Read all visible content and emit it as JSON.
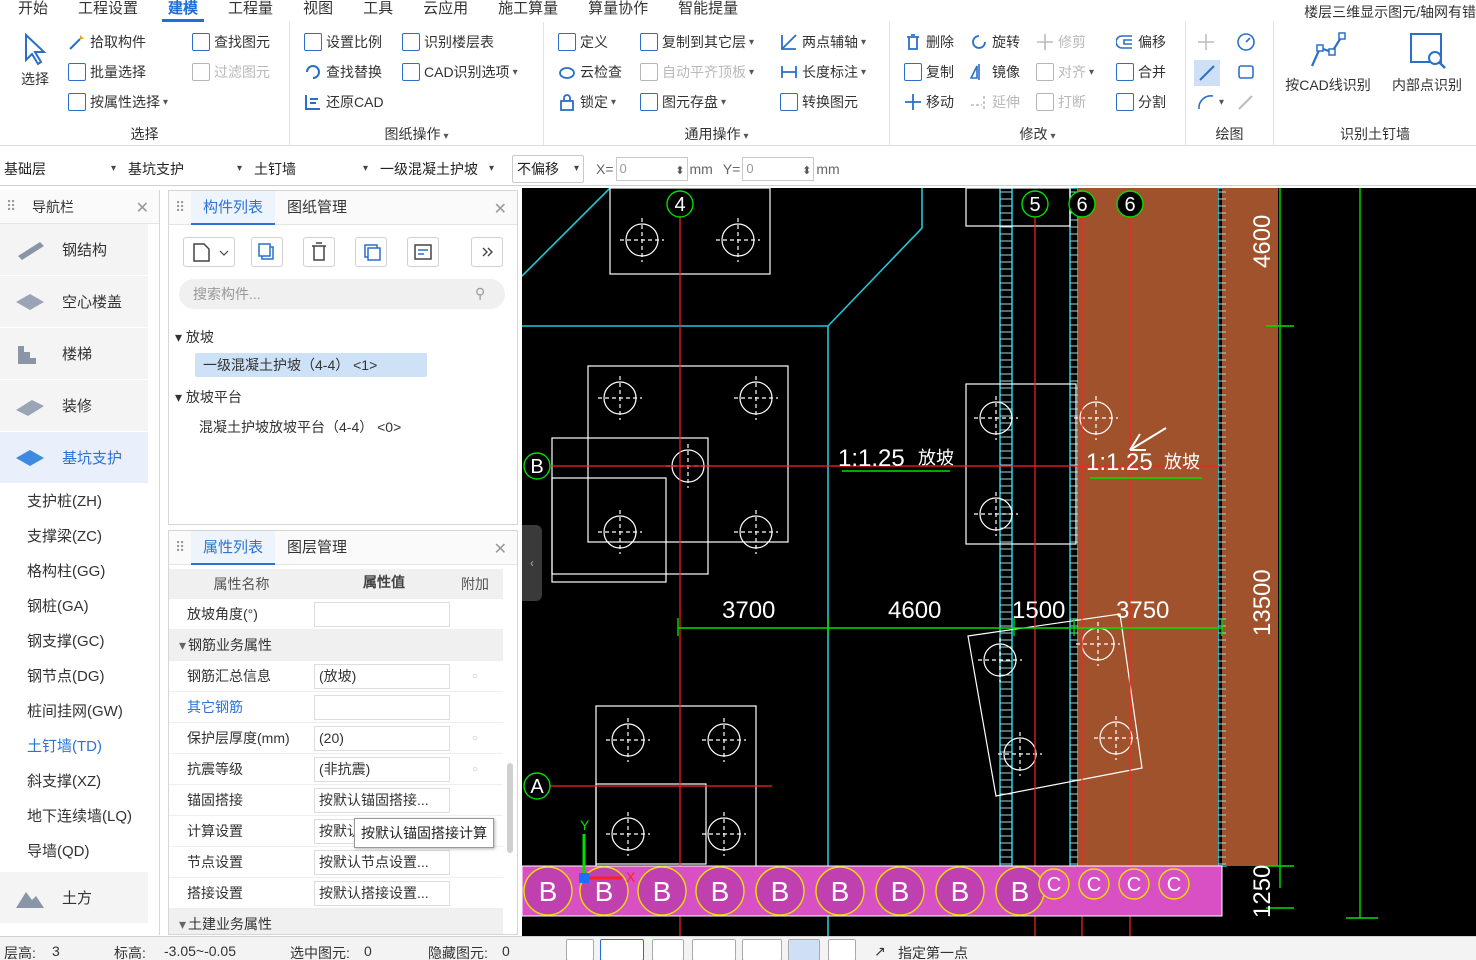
{
  "menu": {
    "items": [
      "开始",
      "工程设置",
      "建模",
      "工程量",
      "视图",
      "工具",
      "云应用",
      "施工算量",
      "算量协作",
      "智能提量"
    ],
    "active_index": 2,
    "right_text": "楼层三维显示图元/轴网有错"
  },
  "ribbon": {
    "select": {
      "select_label": "选择",
      "pick": "拾取构件",
      "batch": "批量选择",
      "by_attr": "按属性选择",
      "find": "查找图元",
      "filter": "过滤图元",
      "title": "选择"
    },
    "drawing": {
      "scale": "设置比例",
      "find_replace": "查找替换",
      "restore": "还原CAD",
      "identify_floor": "识别楼层表",
      "cad_options": "CAD识别选项",
      "title": "图纸操作"
    },
    "common": {
      "define": "定义",
      "cloud_check": "云检查",
      "lock": "锁定",
      "copy_floor": "复制到其它层",
      "auto_align": "自动平齐顶板",
      "store": "图元存盘",
      "aux": "两点辅轴",
      "dim": "长度标注",
      "convert": "转换图元",
      "title": "通用操作"
    },
    "modify": {
      "delete": "删除",
      "copy": "复制",
      "move": "移动",
      "rotate": "旋转",
      "mirror": "镜像",
      "extend": "延伸",
      "trim": "修剪",
      "align": "对齐",
      "break": "打断",
      "offset": "偏移",
      "merge": "合并",
      "split": "分割",
      "title": "修改"
    },
    "draw": {
      "title": "绘图"
    },
    "identify": {
      "by_line": "按CAD线识别",
      "inner": "内部点识别",
      "title": "识别土钉墙"
    }
  },
  "options": {
    "floor": "基础层",
    "category": "基坑支护",
    "type": "土钉墙",
    "component": "一级混凝土护坡",
    "offset": "不偏移",
    "x_label": "X=",
    "x_value": "0",
    "y_label": "Y=",
    "y_value": "0",
    "unit": "mm"
  },
  "nav": {
    "title": "导航栏",
    "categories": [
      "钢结构",
      "空心楼盖",
      "楼梯",
      "装修",
      "基坑支护"
    ],
    "active_category": "基坑支护",
    "items": [
      "支护桩(ZH)",
      "支撑梁(ZC)",
      "格构柱(GG)",
      "钢桩(GA)",
      "钢支撑(GC)",
      "钢节点(DG)",
      "桩间挂网(GW)",
      "土钉墙(TD)",
      "斜支撑(XZ)",
      "地下连续墙(LQ)",
      "导墙(QD)"
    ],
    "active_item": "土钉墙(TD)",
    "bottom_category": "土方"
  },
  "component_list": {
    "tabs": [
      "构件列表",
      "图纸管理"
    ],
    "search_placeholder": "搜索构件...",
    "groups": [
      {
        "name": "放坡",
        "items": [
          "一级混凝土护坡（4-4）  <1>"
        ]
      },
      {
        "name": "放坡平台",
        "items": [
          "混凝土护坡放坡平台（4-4）  <0>"
        ]
      }
    ]
  },
  "properties": {
    "tabs": [
      "属性列表",
      "图层管理"
    ],
    "headers": [
      "属性名称",
      "属性值",
      "附加"
    ],
    "rows": [
      {
        "name": "放坡角度(°)",
        "value": "",
        "type": "row"
      },
      {
        "name": "钢筋业务属性",
        "value": "",
        "type": "section"
      },
      {
        "name": "钢筋汇总信息",
        "value": "(放坡)",
        "type": "row",
        "extra": "○"
      },
      {
        "name": "其它钢筋",
        "value": "",
        "type": "link"
      },
      {
        "name": "保护层厚度(mm)",
        "value": "(20)",
        "type": "row",
        "extra": "○"
      },
      {
        "name": "抗震等级",
        "value": "(非抗震)",
        "type": "row",
        "extra": "○"
      },
      {
        "name": "锚固搭接",
        "value": "按默认锚固搭接...",
        "type": "row"
      },
      {
        "name": "计算设置",
        "value": "按默认",
        "type": "row"
      },
      {
        "name": "节点设置",
        "value": "按默认节点设置...",
        "type": "row"
      },
      {
        "name": "搭接设置",
        "value": "按默认搭接设置...",
        "type": "row"
      },
      {
        "name": "土建业务属性",
        "value": "",
        "type": "section"
      }
    ],
    "tooltip": "按默认锚固搭接计算"
  },
  "canvas": {
    "axis_labels_top": [
      "4",
      "5",
      "6",
      "6"
    ],
    "axis_labels_left": [
      "B",
      "A"
    ],
    "slope_text": "1:1.25",
    "slope_word": "放坡",
    "dims_horizontal": [
      "3700",
      "4600",
      "1500",
      "3750"
    ],
    "dims_vertical": [
      "4600",
      "13500",
      "1250"
    ],
    "pile_label": "B",
    "pile_label_c": "C",
    "ucs_x": "X",
    "ucs_y": "Y",
    "colors": {
      "wall": "#a0522d",
      "pile_band": "#d94fc4",
      "dim": "#00e000",
      "axis": "#ff2020",
      "outline": "#20c8d8",
      "grid": "#ffffff",
      "pile_ring": "#e8e000"
    }
  },
  "status": {
    "floor_height_label": "层高:",
    "floor_height": "3",
    "elevation_label": "标高:",
    "elevation": "-3.05~-0.05",
    "selected_label": "选中图元:",
    "selected": "0",
    "hidden_label": "隐藏图元:",
    "hidden": "0",
    "prompt": "指定第一点"
  }
}
